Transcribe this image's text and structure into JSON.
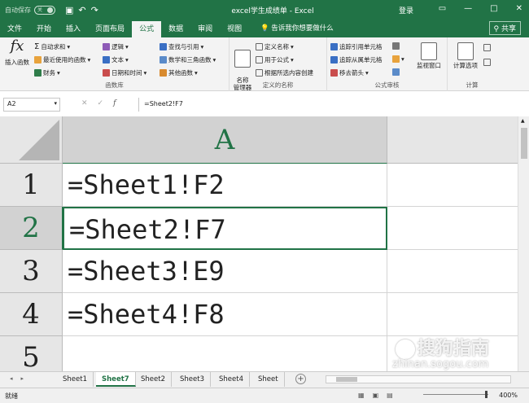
{
  "titlebar": {
    "autosave": "自动保存",
    "toggle": "关",
    "title": "excel学生成绩单  -  Excel",
    "login": "登录",
    "min": "—",
    "restore": "□",
    "close": "✕"
  },
  "tabs": [
    "文件",
    "开始",
    "插入",
    "页面布局",
    "公式",
    "数据",
    "审阅",
    "视图"
  ],
  "active_tab": "公式",
  "tellme": "告诉我你想要做什么",
  "share": "共享",
  "ribbon": {
    "insert_function": "插入函数",
    "autosum": "自动求和",
    "recent": "最近使用的函数",
    "financial": "财务",
    "logical": "逻辑",
    "text": "文本",
    "datetime": "日期和时间",
    "lookup": "查找与引用",
    "math": "数学和三角函数",
    "other": "其他函数",
    "group_library": "函数库",
    "name_manager": "名称\n管理器",
    "define_name": "定义名称",
    "use_in_formula": "用于公式",
    "create_from_sel": "根据所选内容创建",
    "group_names": "定义的名称",
    "trace_precedents": "追踪引用单元格",
    "trace_dependents": "追踪从属单元格",
    "remove_arrows": "移去箭头",
    "watch_window": "监视窗口",
    "group_audit": "公式审核",
    "calc_options": "计算选项",
    "group_calc": "计算"
  },
  "formula_bar": {
    "name_box": "A2",
    "formula": "=Sheet2!F7"
  },
  "grid": {
    "column_header": "A",
    "rows": [
      {
        "num": "1",
        "value": "=Sheet1!F2"
      },
      {
        "num": "2",
        "value": "=Sheet2!F7"
      },
      {
        "num": "3",
        "value": "=Sheet3!E9"
      },
      {
        "num": "4",
        "value": "=Sheet4!F8"
      },
      {
        "num": "5",
        "value": ""
      }
    ]
  },
  "sheet_tabs": [
    "Sheet1",
    "Sheet7",
    "Sheet2",
    "Sheet3",
    "Sheet4",
    "Sheet"
  ],
  "active_sheet": "Sheet7",
  "status": {
    "ready": "就绪",
    "zoom": "400%"
  },
  "watermark": {
    "brand": "搜狗指南",
    "url": "zhinan.sogou.com"
  }
}
